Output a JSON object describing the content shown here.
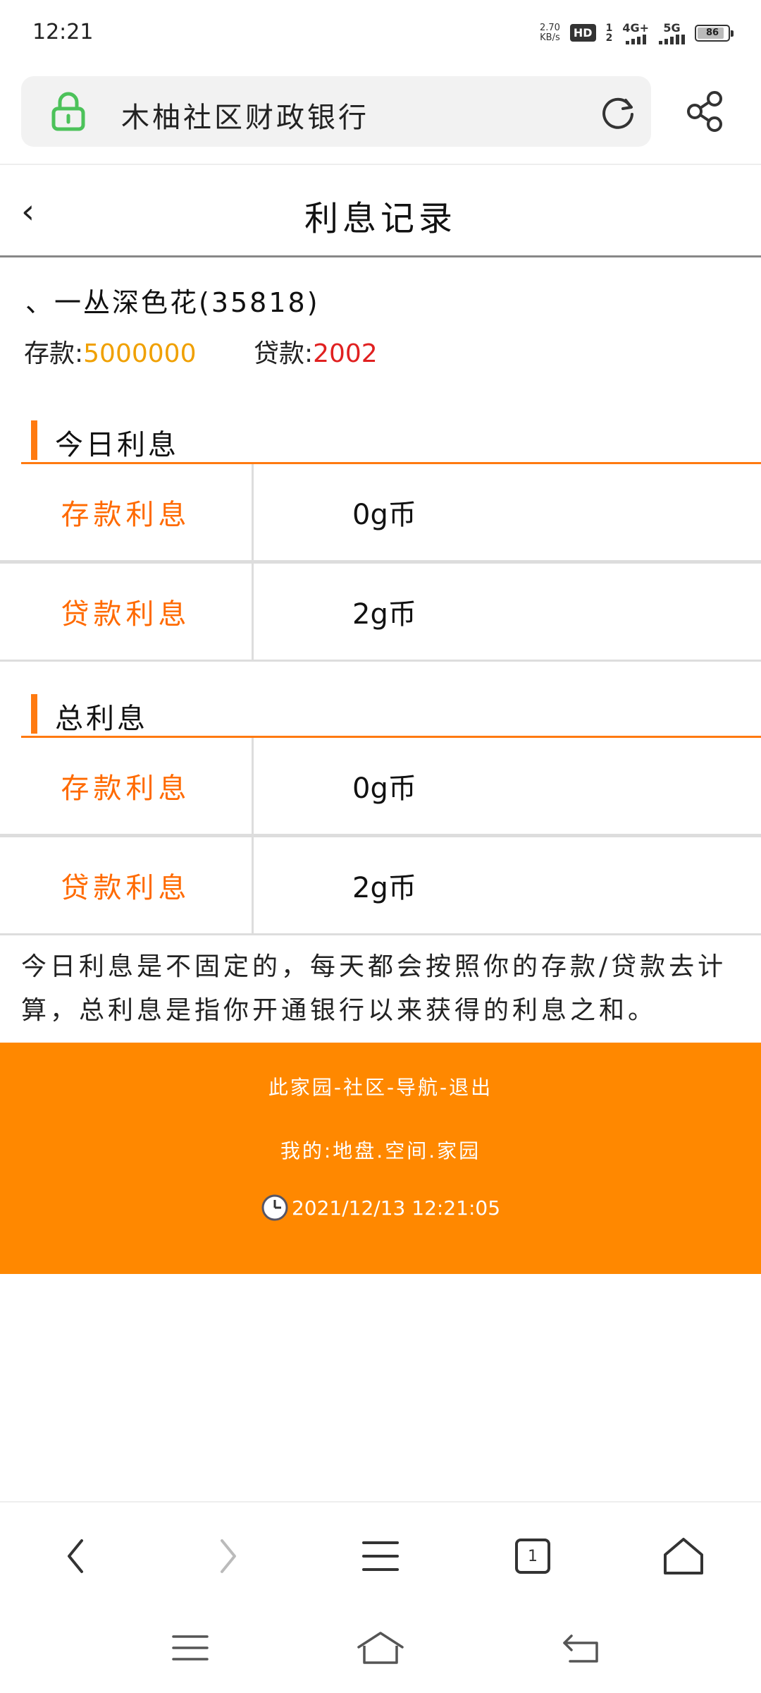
{
  "status_bar": {
    "time": "12:21",
    "net_speed_value": "2.70",
    "net_speed_unit": "KB/s",
    "hd": "HD",
    "sim_top": "1",
    "sim_bottom": "2",
    "net1": "4G+",
    "net2": "5G",
    "battery": "86"
  },
  "address_bar": {
    "title": "木柚社区财政银行"
  },
  "header": {
    "back": "‹",
    "title": "利息记录"
  },
  "user": {
    "name": "、一丛深色花(35818)",
    "deposit_label": "存款:",
    "deposit_value": "5000000",
    "loan_label": "贷款:",
    "loan_value": "2002"
  },
  "sections": [
    {
      "title": "今日利息",
      "rows": [
        {
          "label": "存款利息",
          "value": "0g币"
        },
        {
          "label": "贷款利息",
          "value": "2g币"
        }
      ]
    },
    {
      "title": "总利息",
      "rows": [
        {
          "label": "存款利息",
          "value": "0g币"
        },
        {
          "label": "贷款利息",
          "value": "2g币"
        }
      ]
    }
  ],
  "note": "今日利息是不固定的，每天都会按照你的存款/贷款去计算，总利息是指你开通银行以来获得的利息之和。",
  "footer": {
    "links": "此家园-社区-导航-退出",
    "mine": "我的:地盘.空间.家园",
    "timestamp": "2021/12/13 12:21:05"
  },
  "browser_bar": {
    "tab_count": "1"
  },
  "colors": {
    "accent": "#ff8800",
    "label_orange": "#ff6a00",
    "deposit": "#f0a000",
    "loan": "#e02020",
    "lock_green": "#4cc25a"
  }
}
